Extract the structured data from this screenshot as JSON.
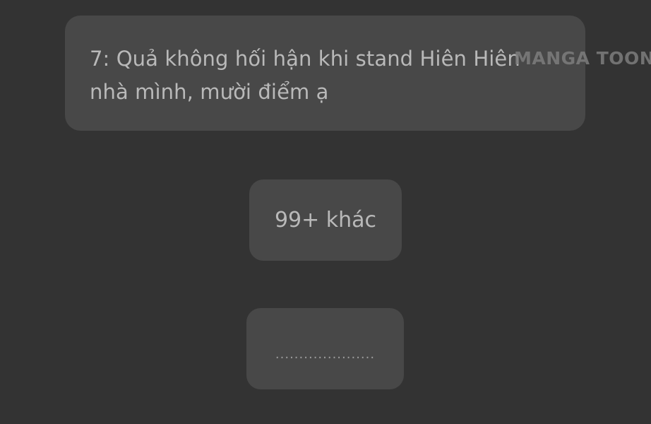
{
  "comment": {
    "text": "7: Quả không hối hận khi stand Hiên Hiên nhà mình, mười điểm ạ"
  },
  "watermark": {
    "text": "MANGA TOON"
  },
  "more_button": {
    "label": "99+ khác"
  },
  "dots_button": {
    "label": "....................."
  },
  "colors": {
    "background": "#333333",
    "card": "#484848",
    "text": "#b9b9b9"
  }
}
